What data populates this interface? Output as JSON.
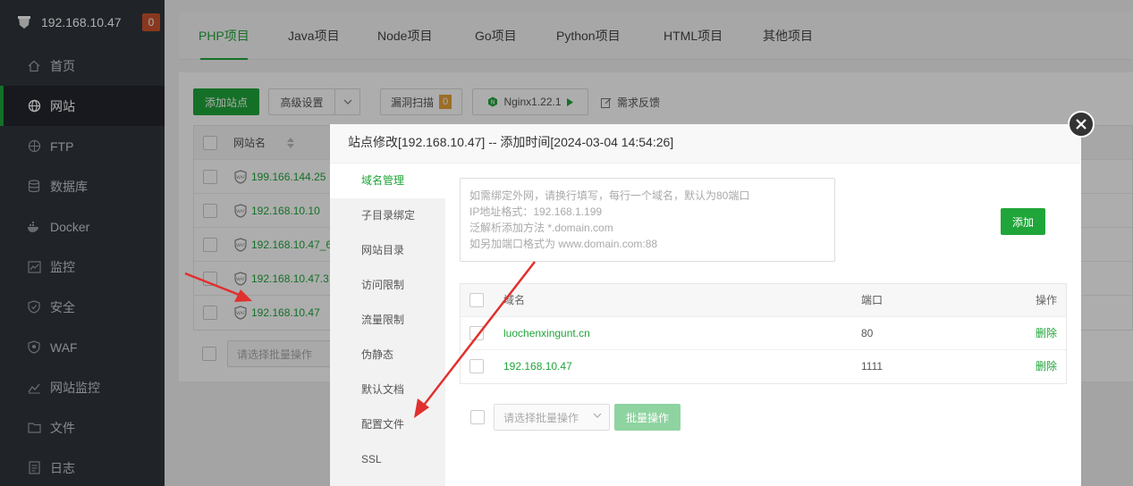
{
  "sidebar": {
    "server_ip": "192.168.10.47",
    "notice_count": "0",
    "items": [
      {
        "label": "首页",
        "icon": "home-icon"
      },
      {
        "label": "网站",
        "icon": "globe-icon"
      },
      {
        "label": "FTP",
        "icon": "ftp-icon"
      },
      {
        "label": "数据库",
        "icon": "database-icon"
      },
      {
        "label": "Docker",
        "icon": "docker-icon"
      },
      {
        "label": "监控",
        "icon": "monitor-icon"
      },
      {
        "label": "安全",
        "icon": "shield-icon"
      },
      {
        "label": "WAF",
        "icon": "waf-icon"
      },
      {
        "label": "网站监控",
        "icon": "chart-icon"
      },
      {
        "label": "文件",
        "icon": "folder-icon"
      },
      {
        "label": "日志",
        "icon": "log-icon"
      }
    ],
    "active_index": 1
  },
  "tabs": [
    "PHP项目",
    "Java项目",
    "Node项目",
    "Go项目",
    "Python项目",
    "HTML项目",
    "其他项目"
  ],
  "toolbar": {
    "add_site": "添加站点",
    "advanced": "高级设置",
    "vuln_scan": "漏洞扫描",
    "vuln_count": "0",
    "nginx": "Nginx1.22.1",
    "feedback": "需求反馈"
  },
  "site_table": {
    "header_name": "网站名",
    "rows": [
      "199.166.144.25",
      "192.168.10.10",
      "192.168.10.47_6",
      "192.168.10.47.3",
      "192.168.10.47"
    ]
  },
  "batch": {
    "placeholder": "请选择批量操作"
  },
  "modal": {
    "title": "站点修改[192.168.10.47] -- 添加时间[2024-03-04 14:54:26]",
    "menu": [
      "域名管理",
      "子目录绑定",
      "网站目录",
      "访问限制",
      "流量限制",
      "伪静态",
      "默认文档",
      "配置文件",
      "SSL"
    ],
    "active_menu": 0,
    "input_placeholder_lines": [
      "如需绑定外网，请换行填写，每行一个域名，默认为80端口",
      "IP地址格式：192.168.1.199",
      "泛解析添加方法 *.domain.com",
      "如另加端口格式为 www.domain.com:88"
    ],
    "add_button": "添加",
    "table": {
      "col_domain": "域名",
      "col_port": "端口",
      "col_op": "操作",
      "rows": [
        {
          "domain": "luochenxingunt.cn",
          "port": "80",
          "op": "删除"
        },
        {
          "domain": "192.168.10.47",
          "port": "1111",
          "op": "删除"
        }
      ]
    },
    "batch_placeholder": "请选择批量操作",
    "batch_button": "批量操作"
  },
  "colors": {
    "accent": "#20a53a",
    "sidebar_bg": "#30353d",
    "arrow": "#e0302d"
  }
}
